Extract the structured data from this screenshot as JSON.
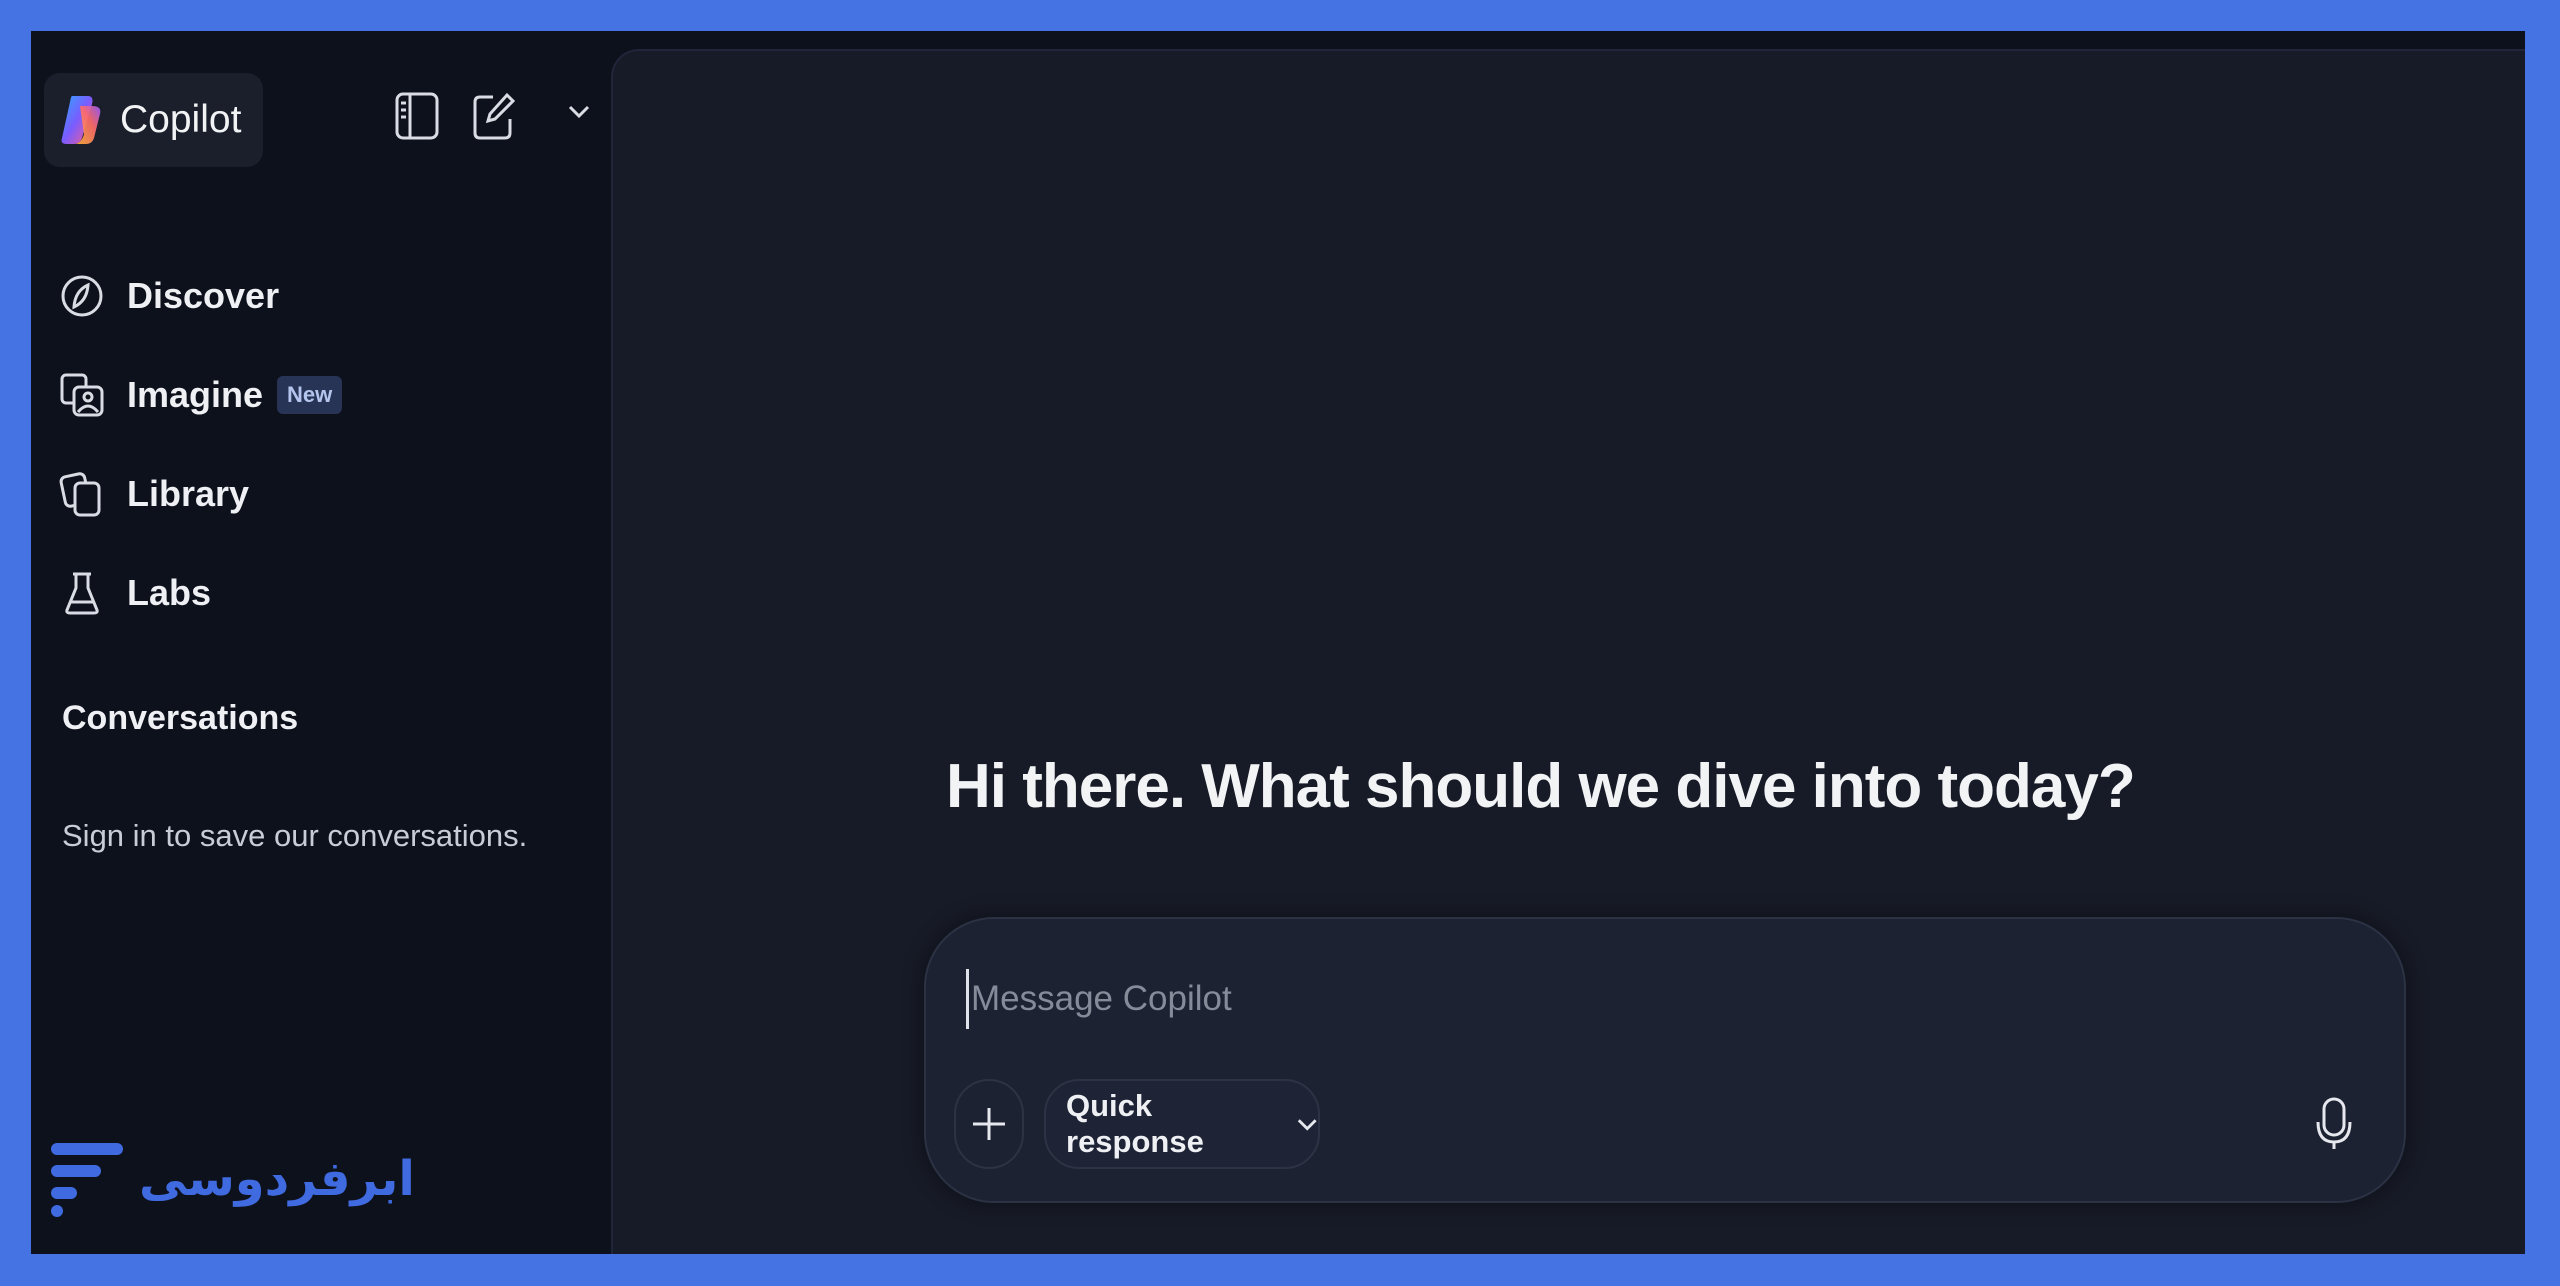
{
  "app": {
    "brand_label": "Copilot"
  },
  "sidebar": {
    "items": [
      {
        "label": "Discover",
        "icon": "compass-icon"
      },
      {
        "label": "Imagine",
        "icon": "image-gallery-icon",
        "badge": "New"
      },
      {
        "label": "Library",
        "icon": "library-icon"
      },
      {
        "label": "Labs",
        "icon": "flask-icon"
      }
    ],
    "conversations_heading": "Conversations",
    "conversations_hint": "Sign in to save our conversations."
  },
  "main": {
    "greeting": "Hi there. What should we dive into today?",
    "composer": {
      "placeholder": "Message Copilot",
      "mode_label": "Quick response"
    }
  },
  "watermark": {
    "text": "ابرفردوسی"
  },
  "colors": {
    "frame": "#4673e3",
    "sidebar_bg": "#0d111c",
    "main_bg": "#171b27",
    "badge_bg": "#273456",
    "watermark": "#3f6ae0"
  }
}
